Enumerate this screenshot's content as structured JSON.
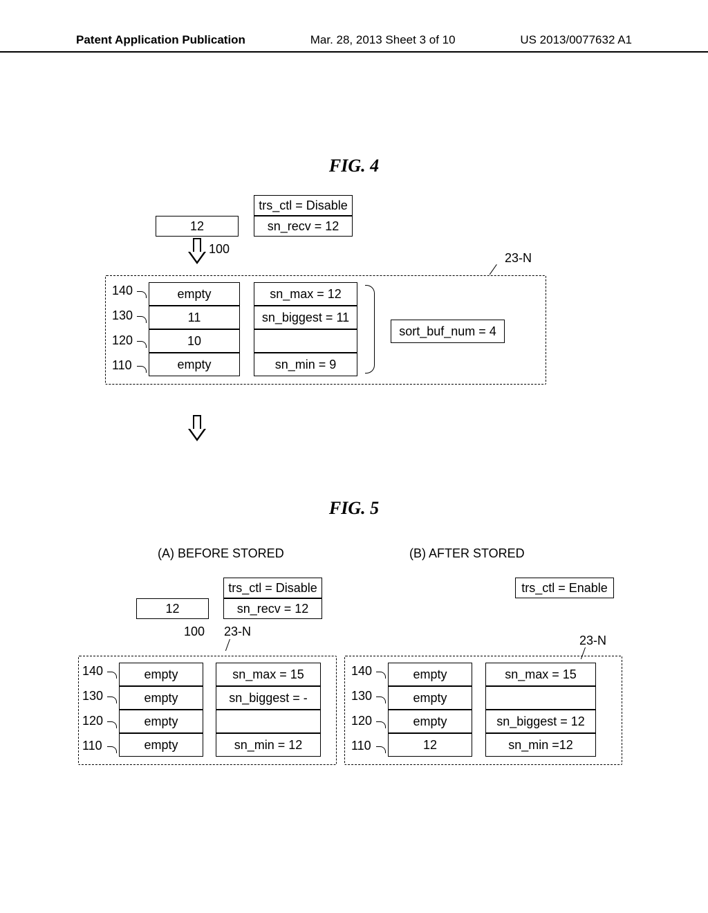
{
  "header": {
    "left": "Patent Application Publication",
    "center": "Mar. 28, 2013  Sheet 3 of 10",
    "right": "US 2013/0077632 A1"
  },
  "fig4": {
    "title": "FIG. 4",
    "trs_ctl": "trs_ctl = Disable",
    "sn_recv": "sn_recv = 12",
    "input": "12",
    "ref100": "100",
    "ref23N": "23-N",
    "lead140": "140",
    "lead130": "130",
    "lead120": "120",
    "lead110": "110",
    "buf140": "empty",
    "buf130": "11",
    "buf120": "10",
    "buf110": "empty",
    "sn_max": "sn_max = 12",
    "sn_biggest": "sn_biggest = 11",
    "sn_min": "sn_min = 9",
    "sort_buf_num": "sort_buf_num = 4"
  },
  "fig5": {
    "title": "FIG. 5",
    "colA_title": "(A) BEFORE STORED",
    "colB_title": "(B) AFTER STORED",
    "A": {
      "trs_ctl": "trs_ctl = Disable",
      "sn_recv": "sn_recv = 12",
      "input": "12",
      "ref100": "100",
      "ref23N": "23-N",
      "lead140": "140",
      "lead130": "130",
      "lead120": "120",
      "lead110": "110",
      "buf140": "empty",
      "buf130": "empty",
      "buf120": "empty",
      "buf110": "empty",
      "sn_max": "sn_max = 15",
      "sn_biggest": "sn_biggest = -",
      "sn_min": "sn_min = 12"
    },
    "B": {
      "trs_ctl": "trs_ctl = Enable",
      "ref23N": "23-N",
      "lead140": "140",
      "lead130": "130",
      "lead120": "120",
      "lead110": "110",
      "buf140": "empty",
      "buf130": "empty",
      "buf120": "empty",
      "buf110": "12",
      "sn_max": "sn_max = 15",
      "sn_biggest": "sn_biggest = 12",
      "sn_min": "sn_min =12"
    }
  }
}
